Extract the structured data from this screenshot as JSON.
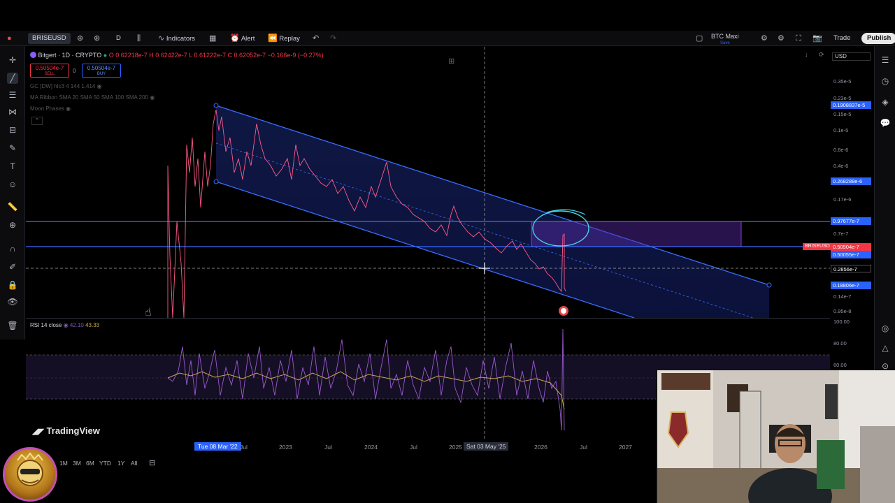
{
  "toolbar": {
    "symbol": "BRISEUSD",
    "interval": "D",
    "indicators": "Indicators",
    "alert": "Alert",
    "replay": "Replay",
    "layout_name": "BTC Maxi",
    "layout_status": "Save",
    "trade": "Trade",
    "publish": "Publish"
  },
  "legend": {
    "title": "Bitgert · 1D · CRYPTO",
    "o": "O 0.62218e-7",
    "h": "H 0.62422e-7",
    "l": "L 0.61222e-7",
    "c": "C 0.62052e-7",
    "change": "−0.166e-9 (−0.27%)",
    "sell_price": "0.50504e-7",
    "sell_label": "SELL",
    "spread": "0",
    "buy_price": "0.50504e-7",
    "buy_label": "BUY",
    "ind1": "GC [DW] hlc3 4 144 1.414",
    "ind2": "MA Ribbon SMA 20 SMA 50 SMA 100 SMA 200",
    "ind3": "Moon Phases"
  },
  "price_axis": {
    "currency": "USD",
    "labels": [
      "0.35e-5",
      "0.23e-5",
      "0.15e-5",
      "0.1e-5",
      "0.6e-6",
      "0.4e-6",
      "0.17e-6",
      "0.7e-7",
      "0.2856e-7",
      "0.14e-7",
      "0.95e-8"
    ],
    "highlight_1": "0.1908837e-5",
    "highlight_2": "0.268288e-6",
    "highlight_3": "0.97677e-7",
    "symbol_tag": "BRISEUSD",
    "current": "0.50504e-7",
    "highlight_4": "0.50055e-7",
    "highlight_5": "0.18806e-7"
  },
  "rsi": {
    "label": "RSI 14 close",
    "v1": "42.10",
    "v2": "43.33",
    "axis": [
      "100.00",
      "80.00",
      "60.00"
    ]
  },
  "time_axis": {
    "start_date": "Tue 08 Mar '22",
    "labels": [
      "Jul",
      "2023",
      "Jul",
      "2024",
      "Jul",
      "2025",
      "2026",
      "Jul",
      "2027"
    ],
    "cursor_date": "Sat 03 May '25"
  },
  "bottom": {
    "ranges": [
      "1M",
      "3M",
      "6M",
      "YTD",
      "1Y",
      "All"
    ]
  },
  "brand": "TradingView",
  "colors": {
    "channel_blue": "#3a6bff",
    "price_line": "#ff5a8a",
    "rsi_line": "#c7a64d",
    "sell_red": "#f23645",
    "buy_blue": "#2962ff"
  }
}
